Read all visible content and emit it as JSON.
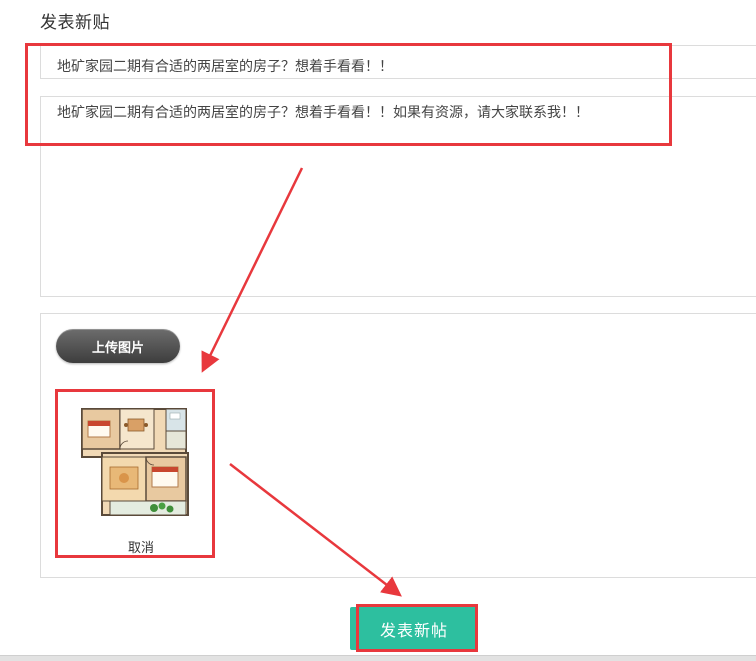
{
  "page": {
    "title": "发表新贴"
  },
  "form": {
    "title_value": "地矿家园二期有合适的两居室的房子？想着手看看！！",
    "content_value": "地矿家园二期有合适的两居室的房子？想着手看看！！如果有资源，请大家联系我！！"
  },
  "upload": {
    "button_label": "上传图片",
    "cancel_label": "取消",
    "thumbnail_icon": "floor-plan-image"
  },
  "actions": {
    "submit_label": "发表新帖"
  },
  "annotations": {
    "color": "#e8383d"
  },
  "theme": {
    "submit_color": "#2dbf9f",
    "upload_button_color": "#4f4f4f"
  }
}
